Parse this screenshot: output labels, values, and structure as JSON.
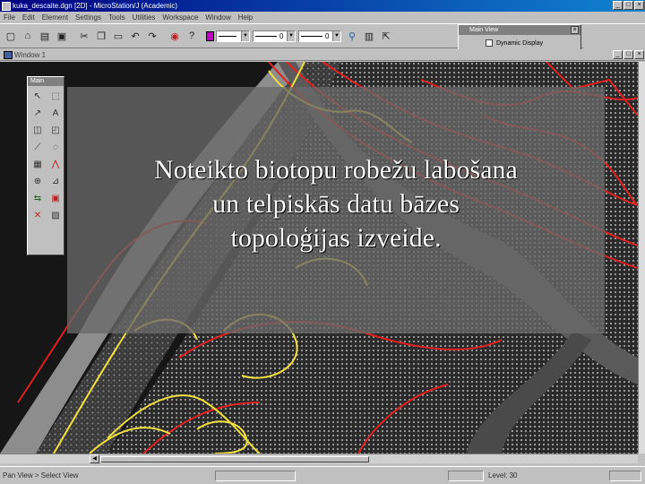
{
  "window": {
    "title": "kuka_descaite.dgn [2D] - MicroStation/J (Academic)",
    "minimize": "_",
    "maximize": "□",
    "close": "×"
  },
  "menu": [
    "File",
    "Edit",
    "Element",
    "Settings",
    "Tools",
    "Utilities",
    "Workspace",
    "Window",
    "Help"
  ],
  "toolbar": {
    "color_swatch": "#c000c0",
    "weight_combo": "0",
    "style_combo": "0"
  },
  "main_view_dialog": {
    "title": "Main View",
    "close": "×",
    "checkbox_label": "Dynamic Display"
  },
  "view_window": {
    "title": "Window 1",
    "minimize": "_",
    "maximize": "□",
    "close": "×"
  },
  "palette": {
    "title": "Main",
    "tools": [
      "select-icon",
      "fence-icon",
      "line-icon",
      "text-icon",
      "circle-icon",
      "arc-icon",
      "polygon-icon",
      "curve-icon",
      "cell-icon",
      "dimension-icon",
      "modify-icon",
      "measure-icon",
      "manipulate-icon",
      "change-icon",
      "delete-icon",
      "drop-icon"
    ]
  },
  "caption": {
    "line1": "Noteikto biotopu robežu labošana",
    "line2": "un telpiskās datu bāzes",
    "line3": "topoloģijas izveide."
  },
  "status": {
    "prompt": "Pan View > Select View",
    "level": "Level: 30"
  }
}
